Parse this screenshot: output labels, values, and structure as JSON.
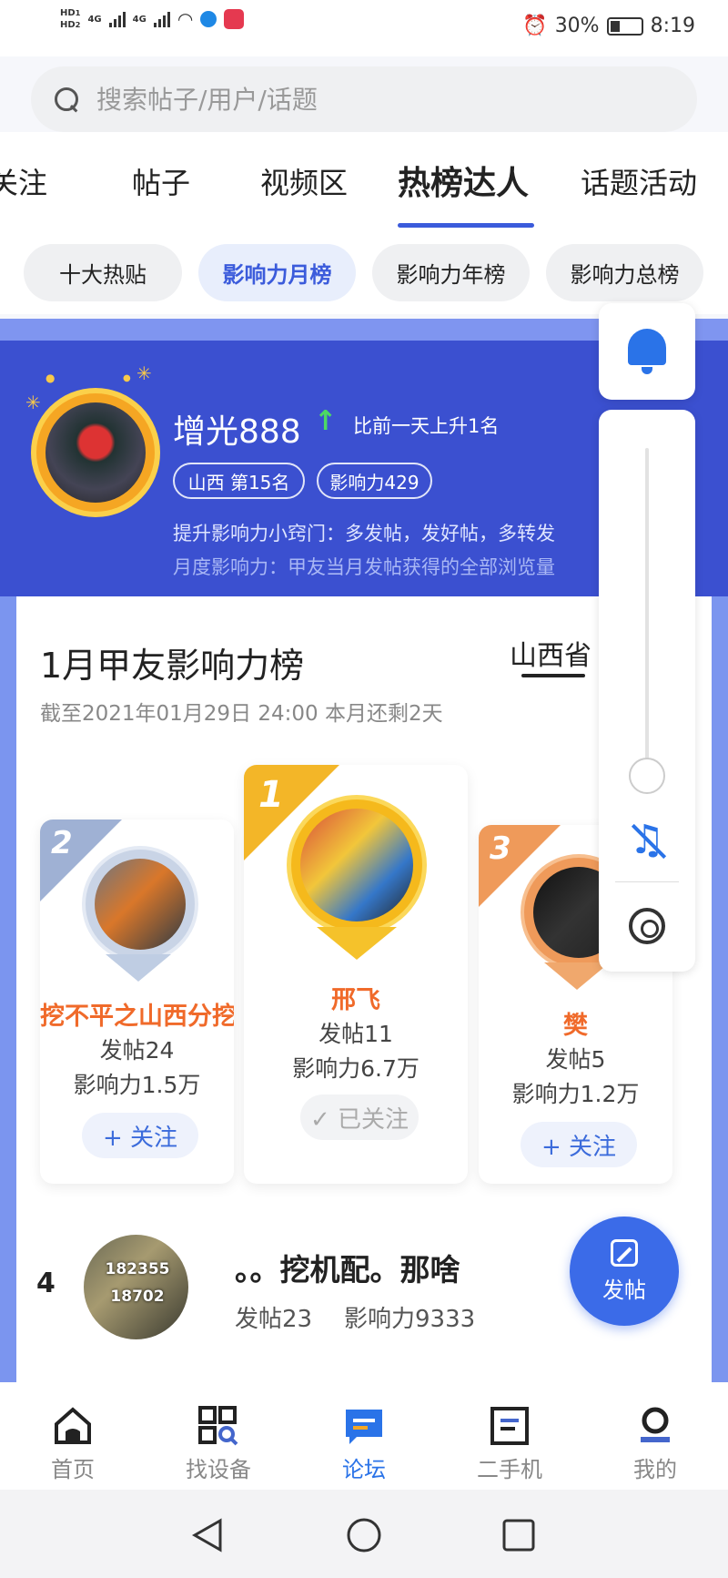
{
  "status_bar": {
    "hd1": "HD",
    "hd1_sub": "1",
    "hd2": "HD",
    "hd2_sub": "2",
    "net1": "4G",
    "net2": "4G",
    "battery": "30%",
    "time": "8:19"
  },
  "search": {
    "placeholder": "搜索帖子/用户/话题"
  },
  "tabs": [
    "关注",
    "帖子",
    "视频区",
    "热榜达人",
    "话题活动"
  ],
  "active_tab": "热榜达人",
  "sub_tabs": [
    "十大热贴",
    "影响力月榜",
    "影响力年榜",
    "影响力总榜"
  ],
  "active_sub_tab": "影响力月榜",
  "me": {
    "name": "增光888",
    "rank_change": "比前一天上升1名",
    "region_rank": "山西 第15名",
    "influence": "影响力429",
    "tip": "提升影响力小窍门：多发帖，发好帖，多转发",
    "note": "月度影响力：甲友当月发帖获得的全部浏览量"
  },
  "board": {
    "title": "1月甲友影响力榜",
    "region_tab": "山西省",
    "deadline": "截至2021年01月29日 24:00 本月还剩2天"
  },
  "podium": [
    {
      "rank": "2",
      "name": "挖不平之山西分挖",
      "posts": "发帖24",
      "influence": "影响力1.5万",
      "button": "+ 关注"
    },
    {
      "rank": "1",
      "name": "邢飞",
      "posts": "发帖11",
      "influence": "影响力6.7万",
      "button": "✓ 已关注"
    },
    {
      "rank": "3",
      "name": "樊",
      "posts": "发帖5",
      "influence": "影响力1.2万",
      "button": "+ 关注"
    }
  ],
  "rank4": {
    "rank": "4",
    "avatar_line1": "182355",
    "avatar_line2": "18702",
    "name": "。。挖机配。那啥",
    "posts": "发帖23",
    "influence": "影响力9333"
  },
  "fab": {
    "label": "发帖"
  },
  "bottom_nav": [
    "首页",
    "找设备",
    "论坛",
    "二手机",
    "我的"
  ],
  "active_nav": "论坛",
  "colors": {
    "accent": "#3b5bdb",
    "banner": "#3b50d0",
    "orange": "#f06a2a",
    "green": "#4cd964"
  }
}
